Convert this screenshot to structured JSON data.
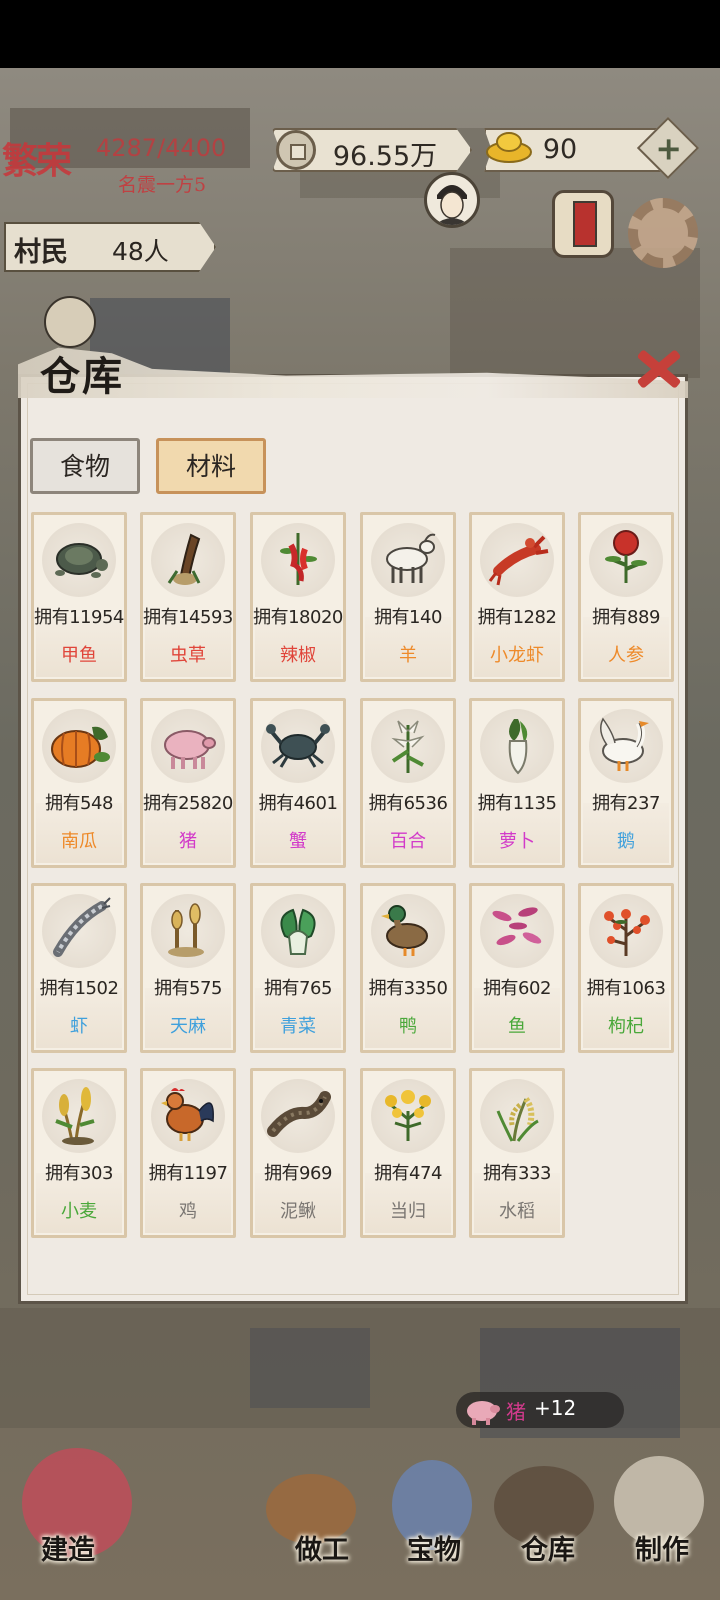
{
  "hud": {
    "prosperity_badge": "繁荣",
    "prosperity_value": "4287/4400",
    "prosperity_rank": "名震一方5",
    "money_value": "96.55万",
    "gold_value": "90",
    "add_label": "+",
    "villagers_label": "村民",
    "villagers_count": "48人"
  },
  "warehouse": {
    "title": "仓库",
    "tabs": [
      {
        "label": "食物",
        "active": false
      },
      {
        "label": "材料",
        "active": true
      }
    ],
    "items": [
      {
        "owned": "拥有11954",
        "name": "甲鱼",
        "name_color": "#e0453a",
        "icon": "turtle-icon"
      },
      {
        "owned": "拥有14593",
        "name": "虫草",
        "name_color": "#e0453a",
        "icon": "cordyceps-icon"
      },
      {
        "owned": "拥有18020",
        "name": "辣椒",
        "name_color": "#e0453a",
        "icon": "chili-icon"
      },
      {
        "owned": "拥有140",
        "name": "羊",
        "name_color": "#ee8a2a",
        "icon": "goat-icon"
      },
      {
        "owned": "拥有1282",
        "name": "小龙虾",
        "name_color": "#ee8a2a",
        "icon": "crayfish-icon"
      },
      {
        "owned": "拥有889",
        "name": "人参",
        "name_color": "#ee8a2a",
        "icon": "ginseng-icon"
      },
      {
        "owned": "拥有548",
        "name": "南瓜",
        "name_color": "#ee8a2a",
        "icon": "pumpkin-icon"
      },
      {
        "owned": "拥有25820",
        "name": "猪",
        "name_color": "#d23bc9",
        "icon": "pig-icon"
      },
      {
        "owned": "拥有4601",
        "name": "蟹",
        "name_color": "#d23bc9",
        "icon": "crab-icon"
      },
      {
        "owned": "拥有6536",
        "name": "百合",
        "name_color": "#d23bc9",
        "icon": "lily-icon"
      },
      {
        "owned": "拥有1135",
        "name": "萝卜",
        "name_color": "#d23bc9",
        "icon": "radish-icon"
      },
      {
        "owned": "拥有237",
        "name": "鹅",
        "name_color": "#3fa0dc",
        "icon": "goose-icon"
      },
      {
        "owned": "拥有1502",
        "name": "虾",
        "name_color": "#3fa0dc",
        "icon": "shrimp-icon"
      },
      {
        "owned": "拥有575",
        "name": "天麻",
        "name_color": "#3fa0dc",
        "icon": "gastrodia-icon"
      },
      {
        "owned": "拥有765",
        "name": "青菜",
        "name_color": "#3fa0dc",
        "icon": "greens-icon"
      },
      {
        "owned": "拥有3350",
        "name": "鸭",
        "name_color": "#4aa83a",
        "icon": "duck-icon"
      },
      {
        "owned": "拥有602",
        "name": "鱼",
        "name_color": "#4aa83a",
        "icon": "fish-icon"
      },
      {
        "owned": "拥有1063",
        "name": "枸杞",
        "name_color": "#4aa83a",
        "icon": "goji-icon"
      },
      {
        "owned": "拥有303",
        "name": "小麦",
        "name_color": "#4aa83a",
        "icon": "wheat-icon"
      },
      {
        "owned": "拥有1197",
        "name": "鸡",
        "name_color": "#7a7672",
        "icon": "rooster-icon"
      },
      {
        "owned": "拥有969",
        "name": "泥鳅",
        "name_color": "#7a7672",
        "icon": "loach-icon"
      },
      {
        "owned": "拥有474",
        "name": "当归",
        "name_color": "#7a7672",
        "icon": "angelica-icon"
      },
      {
        "owned": "拥有333",
        "name": "水稻",
        "name_color": "#7a7672",
        "icon": "rice-icon"
      }
    ]
  },
  "toast": {
    "item": "猪",
    "amount": "+12"
  },
  "bottom_nav": [
    {
      "label": "建造",
      "icon": "build-icon"
    },
    {
      "label": "做工",
      "icon": "work-icon"
    },
    {
      "label": "宝物",
      "icon": "treasure-icon"
    },
    {
      "label": "仓库",
      "icon": "warehouse-icon"
    },
    {
      "label": "制作",
      "icon": "craft-icon"
    }
  ]
}
